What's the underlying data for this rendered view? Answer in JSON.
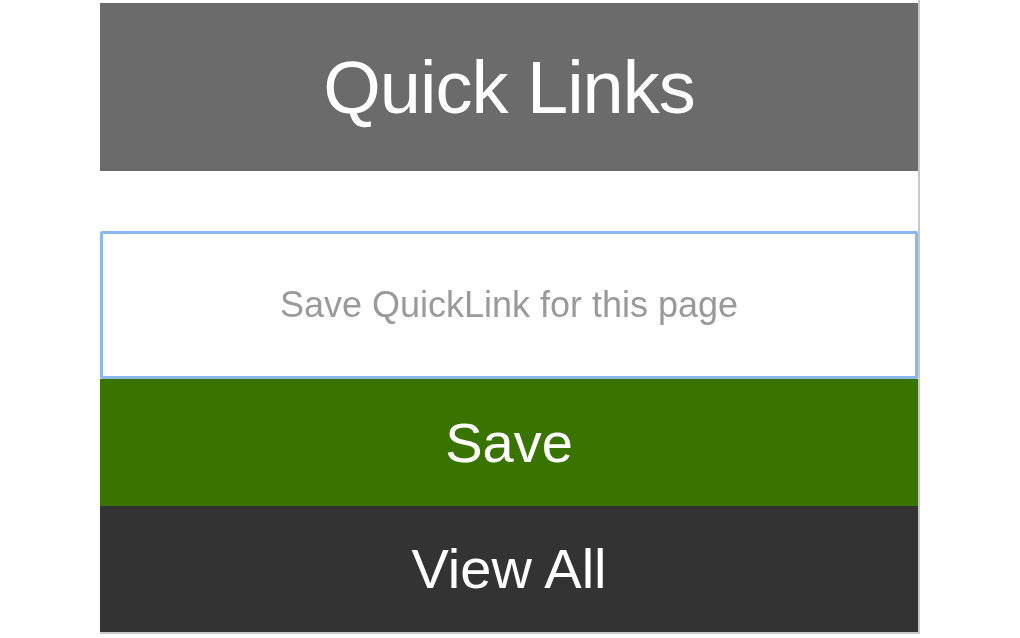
{
  "header": {
    "title": "Quick Links"
  },
  "link_field": {
    "placeholder": "Save QuickLink for this page"
  },
  "buttons": [
    {
      "label": "Save",
      "kind": "primary"
    },
    {
      "label": "View All",
      "kind": "secondary"
    }
  ]
}
